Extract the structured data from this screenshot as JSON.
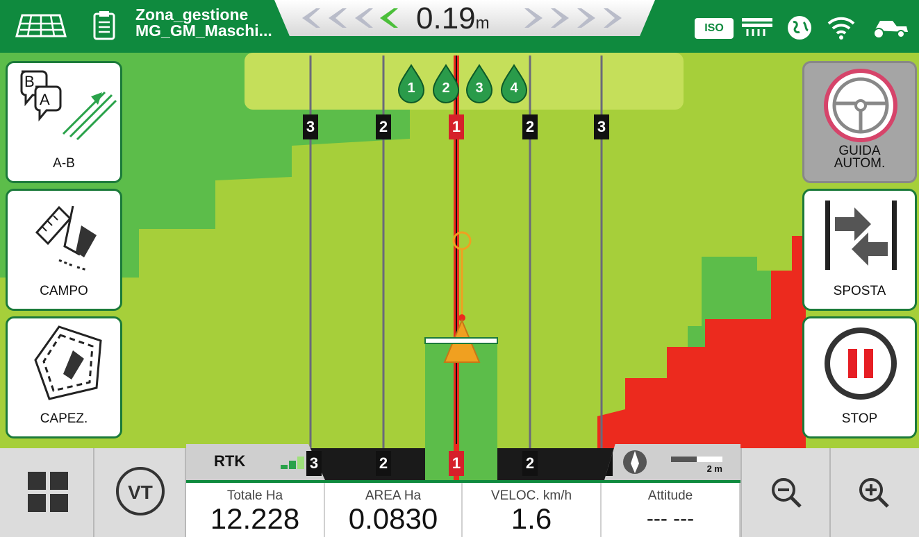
{
  "topbar": {
    "zone_line1": "Zona_gestione",
    "zone_line2": "MG_GM_Maschi...",
    "offset_value": "0.19",
    "offset_unit": "m",
    "iso_label": "ISO",
    "icons": [
      "field-grid-icon",
      "clipboard-icon",
      "implement-icon",
      "gps-globe-icon",
      "wifi-icon",
      "tractor-icon"
    ]
  },
  "rows": {
    "top_labels": [
      "3",
      "2",
      "1",
      "2",
      "3"
    ],
    "sections": [
      "1",
      "2",
      "3",
      "4"
    ]
  },
  "left_buttons": [
    {
      "label": "A-B",
      "icon": "ab-line-icon",
      "badge_b": "B",
      "badge_a": "A"
    },
    {
      "label": "CAMPO",
      "icon": "field-boundary-icon"
    },
    {
      "label": "CAPEZ.",
      "icon": "headland-icon"
    }
  ],
  "right_buttons": [
    {
      "label": "GUIDA AUTOM.",
      "line1": "GUIDA",
      "line2": "AUTOM.",
      "icon": "steering-wheel-icon"
    },
    {
      "label": "SPOSTA",
      "icon": "shift-line-icon"
    },
    {
      "label": "STOP",
      "icon": "pause-icon"
    }
  ],
  "bottom": {
    "vt_label": "VT",
    "rtk_label": "RTK",
    "scale_label": "2 m",
    "stats": [
      {
        "header": "Totale Ha",
        "value": "12.228"
      },
      {
        "header": "AREA Ha",
        "value": "0.0830"
      },
      {
        "header": "VELOC. km/h",
        "value": "1.6"
      },
      {
        "header": "Attitude",
        "value": "--- ---"
      }
    ]
  },
  "colors": {
    "bar_green": "#0f8a3e",
    "map_light": "#a6cf3a",
    "map_dark": "#5cbd4a",
    "map_pale": "#c5df5a",
    "red_zone": "#ec2a1e"
  }
}
